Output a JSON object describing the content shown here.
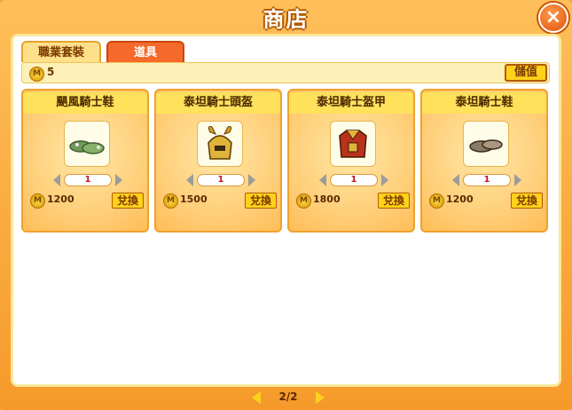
{
  "window": {
    "title": "商店",
    "close_icon": "close-icon"
  },
  "tabs": [
    {
      "label": "職業套裝",
      "active": false
    },
    {
      "label": "道具",
      "active": true
    }
  ],
  "currency": {
    "icon": "coin-icon",
    "coin_symbol": "M",
    "balance": "5",
    "recharge_label": "儲值"
  },
  "items": [
    {
      "name": "颶風騎士鞋",
      "icon": "boots-icon",
      "quantity": "1",
      "price": "1200",
      "exchange_label": "兌換"
    },
    {
      "name": "泰坦騎士頭盔",
      "icon": "helmet-icon",
      "quantity": "1",
      "price": "1500",
      "exchange_label": "兌換"
    },
    {
      "name": "泰坦騎士盔甲",
      "icon": "armor-icon",
      "quantity": "1",
      "price": "1800",
      "exchange_label": "兌換"
    },
    {
      "name": "泰坦騎士鞋",
      "icon": "boots-icon",
      "quantity": "1",
      "price": "1200",
      "exchange_label": "兌換"
    }
  ],
  "pagination": {
    "current": "2/2"
  }
}
